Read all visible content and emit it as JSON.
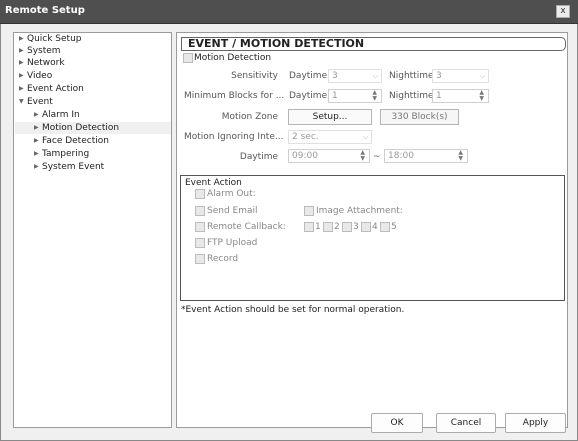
{
  "window": {
    "title": "Remote Setup",
    "close_glyph": "x"
  },
  "tree": {
    "items": [
      {
        "label": "Quick Setup",
        "arrow": "▶"
      },
      {
        "label": "System",
        "arrow": "▶"
      },
      {
        "label": "Network",
        "arrow": "▶"
      },
      {
        "label": "Video",
        "arrow": "▶"
      },
      {
        "label": "Event Action",
        "arrow": "▶"
      },
      {
        "label": "Event",
        "arrow": "▼"
      },
      {
        "label": "Alarm In",
        "arrow": "▶"
      },
      {
        "label": "Motion Detection",
        "arrow": "▶"
      },
      {
        "label": "Face Detection",
        "arrow": "▶"
      },
      {
        "label": "Tampering",
        "arrow": "▶"
      },
      {
        "label": "System Event",
        "arrow": "▶"
      }
    ]
  },
  "panel": {
    "title": "EVENT / MOTION DETECTION",
    "motion_detection_label": "Motion Detection",
    "sensitivity": {
      "label": "Sensitivity",
      "daytime_label": "Daytime",
      "daytime_value": "3",
      "nighttime_label": "Nighttime",
      "nighttime_value": "3"
    },
    "min_blocks": {
      "label": "Minimum Blocks for ...",
      "daytime_label": "Daytime",
      "daytime_value": "1",
      "nighttime_label": "Nighttime",
      "nighttime_value": "1"
    },
    "motion_zone": {
      "label": "Motion Zone",
      "button": "Setup...",
      "blocks": "330 Block(s)"
    },
    "ignoring": {
      "label": "Motion Ignoring Inte...",
      "value": "2 sec."
    },
    "daytime_range": {
      "label": "Daytime",
      "from": "09:00",
      "sep": "~",
      "to": "18:00"
    },
    "event_action": {
      "title": "Event Action",
      "alarm_out": "Alarm Out:",
      "send_email": "Send Email",
      "image_attachment": "Image Attachment:",
      "remote_callback": "Remote Callback:",
      "callbacks": [
        "1",
        "2",
        "3",
        "4",
        "5"
      ],
      "ftp_upload": "FTP Upload",
      "record": "Record"
    },
    "note": "*Event Action should be set for normal operation."
  },
  "footer": {
    "ok": "OK",
    "cancel": "Cancel",
    "apply": "Apply"
  }
}
